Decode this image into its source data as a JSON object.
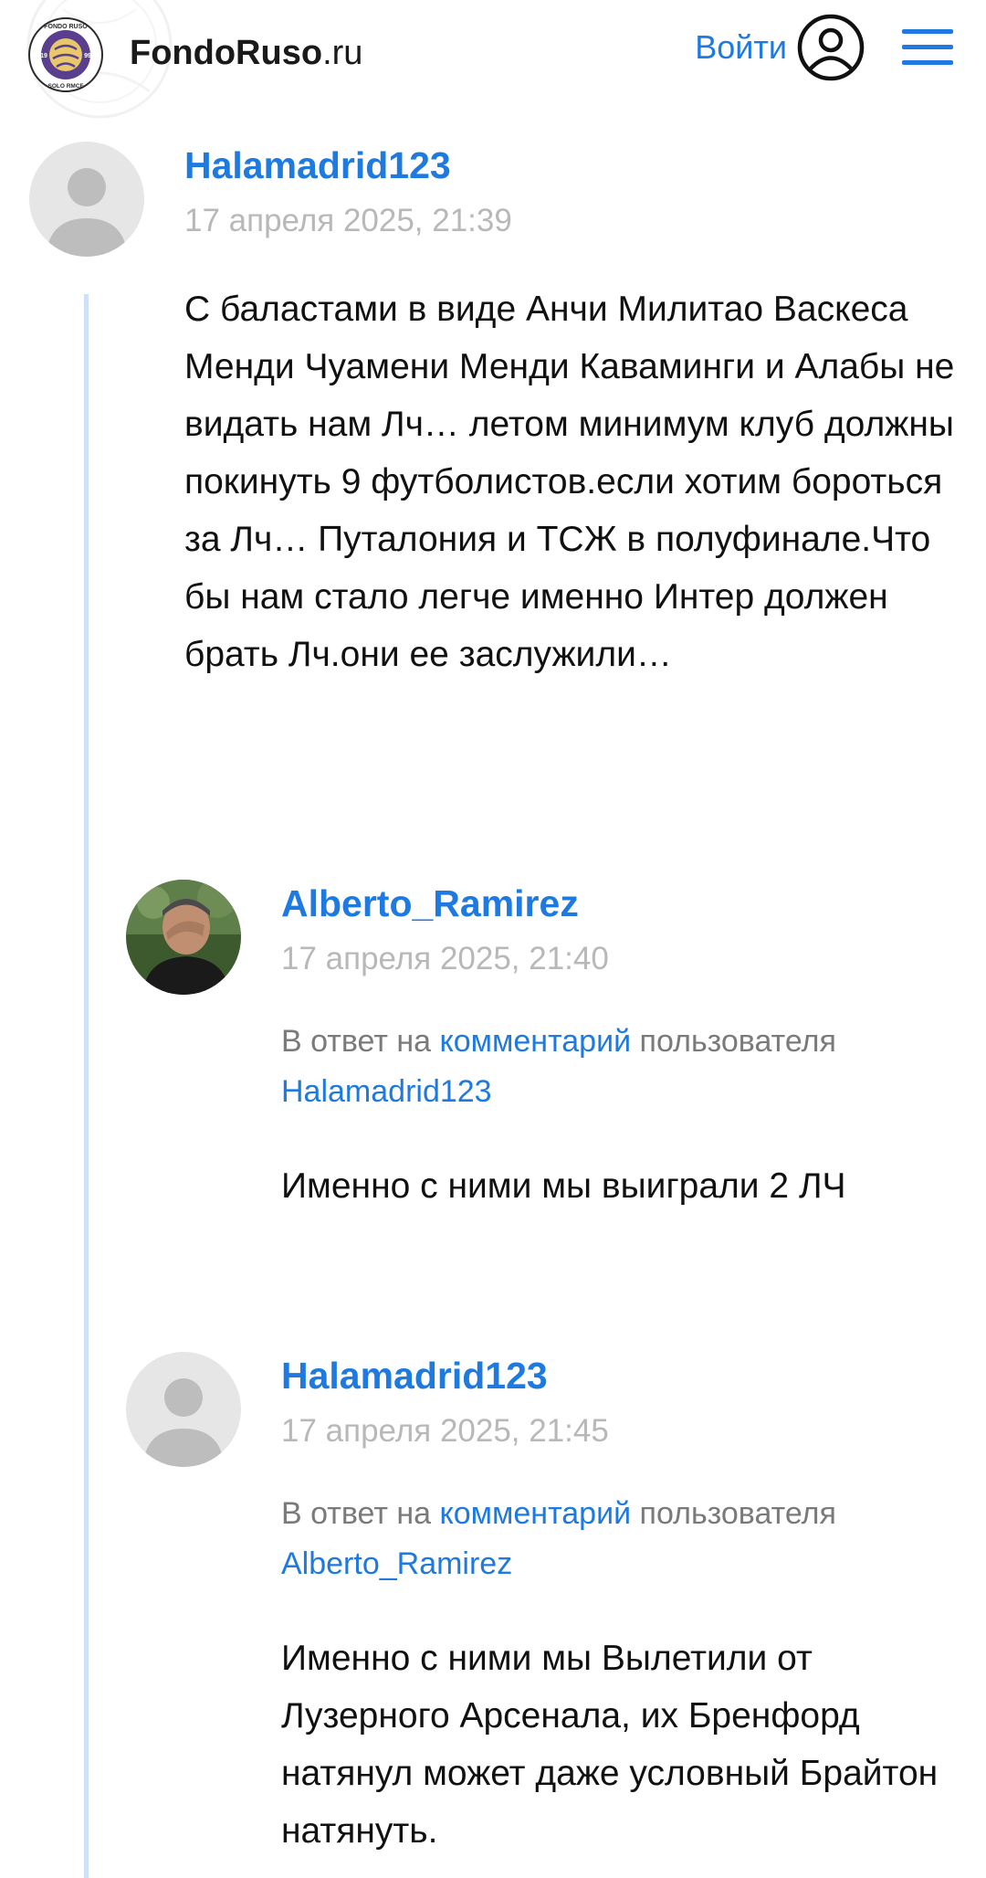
{
  "header": {
    "brand_bold": "FondoRuso",
    "brand_suffix": ".ru",
    "logo_top_text": "FONDO RUSO",
    "logo_bottom_text": "SOLO RMCF",
    "logo_year_left": "19",
    "logo_year_right": "99",
    "login_label": "Войти",
    "user_icon": "user-circle-icon",
    "menu_icon": "hamburger-menu-icon"
  },
  "comments": [
    {
      "author": "Halamadrid123",
      "date": "17 апреля 2025, 21:39",
      "avatar": "default-avatar",
      "text": "С баластами в виде Анчи Милитао Васкеса Менди Чуамени Менди Каваминги и Алабы не видать нам Лч… летом минимум клуб должны покинуть 9 футболистов.если хотим бороться за Лч… Путалония и ТСЖ в полуфинале.Что бы нам стало легче именно Интер должен брать Лч.они ее заслужили…"
    },
    {
      "author": "Alberto_Ramirez",
      "date": "17 апреля 2025, 21:40",
      "avatar": "photo-avatar",
      "reply_prefix": "В ответ на",
      "reply_link": "комментарий",
      "reply_middle": "пользователя",
      "reply_user": "Halamadrid123",
      "text": "Именно с ними мы выиграли 2 ЛЧ"
    },
    {
      "author": "Halamadrid123",
      "date": "17 апреля 2025, 21:45",
      "avatar": "default-avatar",
      "reply_prefix": "В ответ на",
      "reply_link": "комментарий",
      "reply_middle": "пользователя",
      "reply_user": "Alberto_Ramirez",
      "text": "Именно с ними мы Вылетили от Лузерного Арсенала, их Бренфорд натянул может даже условный Брайтон натянуть."
    }
  ],
  "colors": {
    "accent": "#1f7ae0",
    "date_gray": "#b8b8b8",
    "thread_line": "#cfe0fa",
    "logo_purple": "#5b3f8f",
    "logo_gold": "#e8c86a"
  }
}
